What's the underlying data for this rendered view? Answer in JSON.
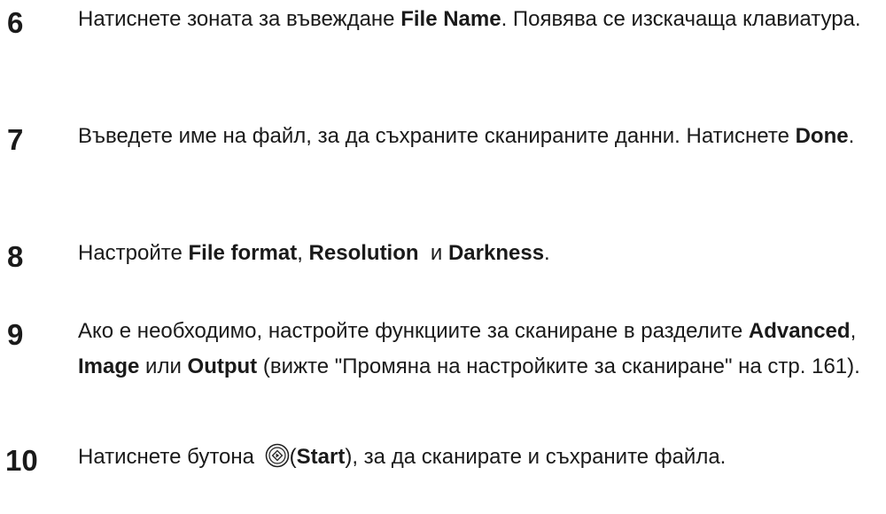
{
  "steps": [
    {
      "number": "6",
      "segments": [
        {
          "text": "Натиснете зоната за въвеждане "
        },
        {
          "text": "File Name",
          "bold": true
        },
        {
          "text": ". Появява се изскачаща клавиатура."
        }
      ]
    },
    {
      "number": "7",
      "segments": [
        {
          "text": "Въведете име на файл, за да съхраните сканираните данни. Натиснете "
        },
        {
          "text": "Done",
          "bold": true
        },
        {
          "text": "."
        }
      ]
    },
    {
      "number": "8",
      "segments": [
        {
          "text": "Настройте "
        },
        {
          "text": "File format",
          "bold": true
        },
        {
          "text": ", "
        },
        {
          "text": "Resolution",
          "bold": true
        },
        {
          "text": "  и "
        },
        {
          "text": "Darkness",
          "bold": true
        },
        {
          "text": "."
        }
      ]
    },
    {
      "number": "9",
      "segments": [
        {
          "text": "Ако е необходимо, настройте функциите за сканиране в разделите "
        },
        {
          "text": "Advanced",
          "bold": true
        },
        {
          "text": ", "
        },
        {
          "text": "Image",
          "bold": true
        },
        {
          "text": " или "
        },
        {
          "text": "Output",
          "bold": true
        },
        {
          "text": " (вижте \"Промяна на настройките за сканиране\" на стр. 161)."
        }
      ]
    },
    {
      "number": "10",
      "icon": "start-button-icon",
      "segments": [
        {
          "text": "Натиснете бутона "
        },
        {
          "icon": true
        },
        {
          "text": "("
        },
        {
          "text": "Start",
          "bold": true
        },
        {
          "text": "), за да сканирате и съхраните файла."
        }
      ]
    }
  ]
}
